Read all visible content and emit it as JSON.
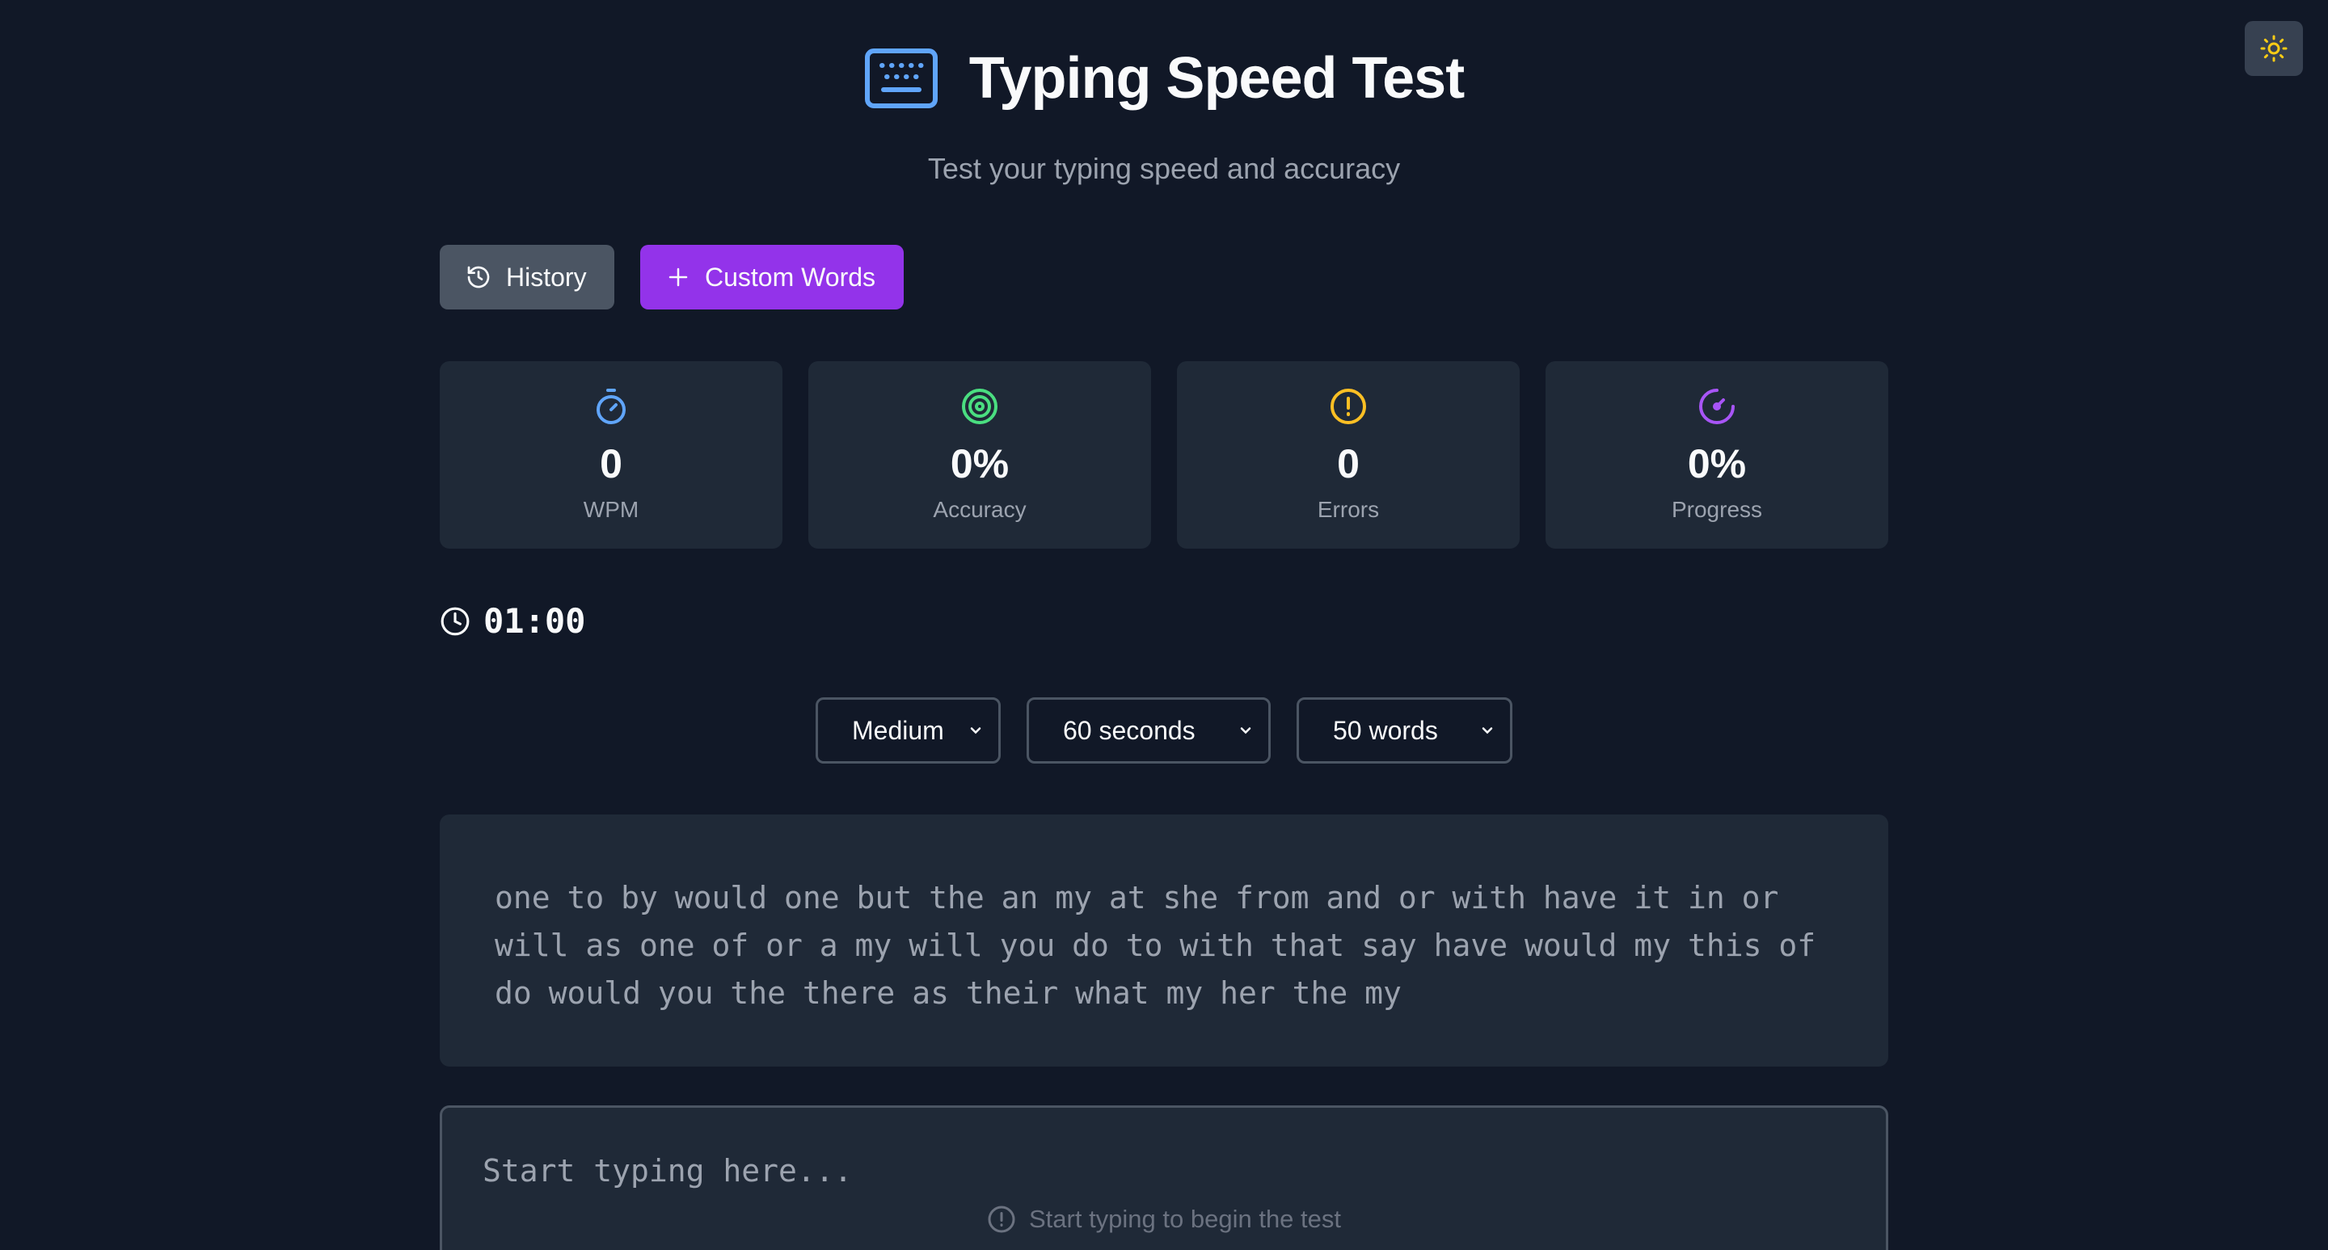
{
  "app": {
    "title": "Typing Speed Test",
    "subtitle": "Test your typing speed and accuracy"
  },
  "toolbar": {
    "history_label": "History",
    "custom_words_label": "Custom Words"
  },
  "stats": {
    "wpm": {
      "value": "0",
      "label": "WPM",
      "icon": "stopwatch-icon"
    },
    "accuracy": {
      "value": "0%",
      "label": "Accuracy",
      "icon": "target-icon"
    },
    "errors": {
      "value": "0",
      "label": "Errors",
      "icon": "alert-circle-icon"
    },
    "progress": {
      "value": "0%",
      "label": "Progress",
      "icon": "gauge-icon"
    }
  },
  "timer": {
    "value": "01:00"
  },
  "settings": {
    "difficulty": {
      "selected": "Medium"
    },
    "duration": {
      "selected": "60 seconds"
    },
    "word_count": {
      "selected": "50 words"
    }
  },
  "target_text": "one to by would one but the an my at she from and or with have it in or will as one of or a my will you do to with that say have would my this of do would you the there as their what my her the my",
  "input": {
    "value": "",
    "placeholder": "Start typing here...",
    "hint": "Start typing to begin the test"
  },
  "colors": {
    "background": "#111827",
    "card": "#1f2937",
    "accent_purple": "#9333ea",
    "wpm_blue": "#60a5fa",
    "accuracy_green": "#4ade80",
    "errors_amber": "#fbbf24",
    "progress_purple": "#a855f7",
    "sun_yellow": "#facc15"
  }
}
